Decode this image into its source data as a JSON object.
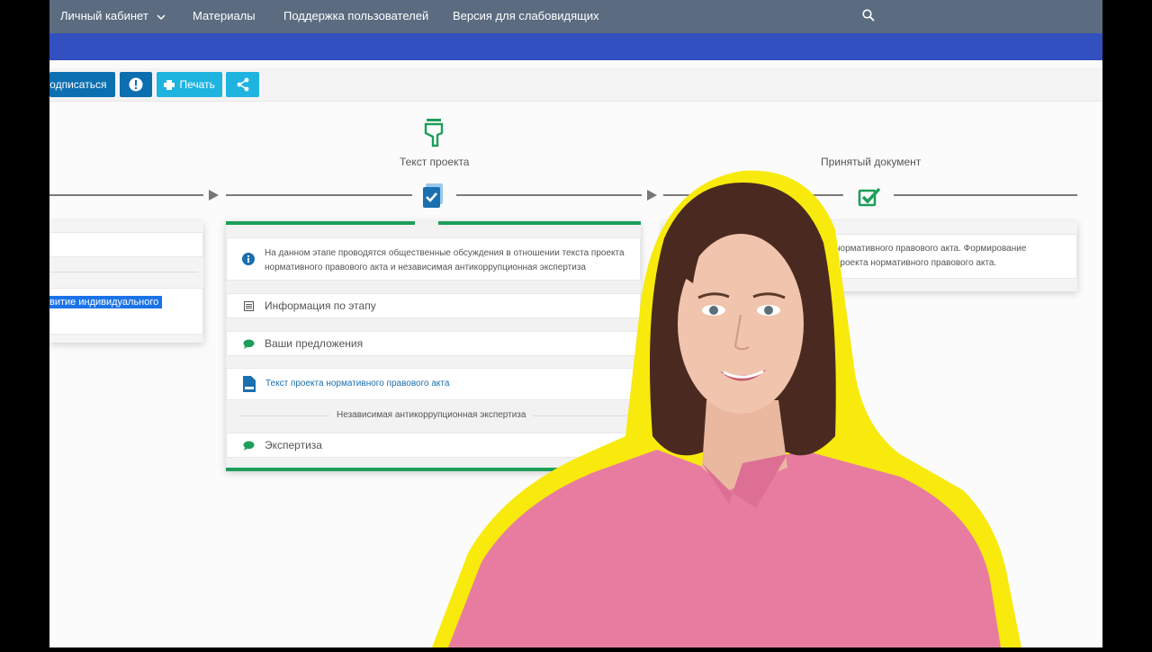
{
  "nav": {
    "account": "Личный кабинет",
    "materials": "Материалы",
    "support": "Поддержка пользователей",
    "accessibility": "Версия для слабовидящих"
  },
  "toolbar": {
    "subscribe": "Подписаться",
    "print": "Печать"
  },
  "stages": {
    "draft_label": "Текст проекта",
    "accepted_label": "Принятый документ"
  },
  "left_card": {
    "highlight": "витие индивидуального"
  },
  "center_card": {
    "info_text_line1": "На данном этапе проводятся общественные обсуждения в отношении текста проекта",
    "info_text_line2": "нормативного правового акта и независимая антикоррупционная экспертиза",
    "stage_info": "Информация по этапу",
    "proposals": "Ваши предложения",
    "draft_doc": "Текст проекта нормативного правового акта",
    "section_title": "Независимая антикоррупционная экспертиза",
    "expertise": "Экспертиза"
  },
  "right_card": {
    "line1": "нормативного правового акта. Формирование",
    "line2": "проекта нормативного правового акта."
  },
  "colors": {
    "nav": "#5b6b80",
    "band": "#3350c0",
    "button_dark": "#0b6fb0",
    "button_light": "#1fb3e0",
    "green": "#1e9e5a",
    "doc_blue": "#1a6fb0",
    "highlight_yellow": "#f8ea0c"
  }
}
